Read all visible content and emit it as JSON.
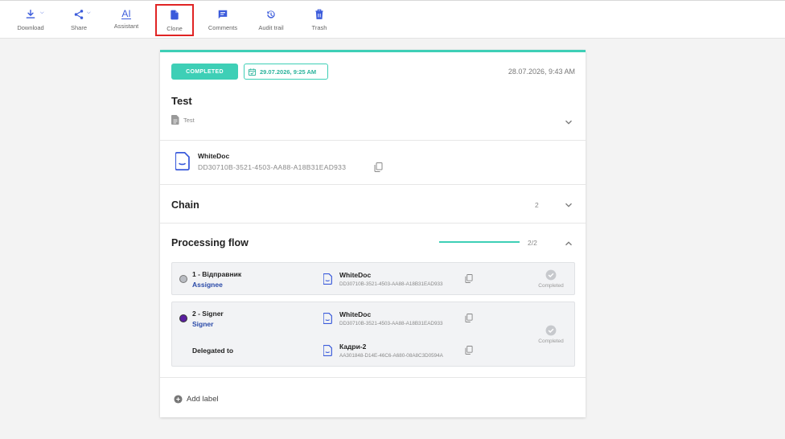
{
  "toolbar": {
    "download": "Download",
    "share": "Share",
    "assistant": "Assistant",
    "assistant_glyph": "AI",
    "clone": "Clone",
    "comments": "Comments",
    "audit_trail": "Audit trail",
    "trash": "Trash"
  },
  "document": {
    "status": "COMPLETED",
    "deadline": "29.07.2026, 9:25 AM",
    "created": "28.07.2026, 9:43 AM",
    "title": "Test",
    "type": "Test",
    "file": {
      "name": "WhiteDoc",
      "id": "DD30710B-3521-4503-AA88-A18B31EAD933"
    }
  },
  "chain": {
    "title": "Chain",
    "count": "2"
  },
  "processing_flow": {
    "title": "Processing flow",
    "progress_text": "2/2",
    "progress_fraction": 1.0,
    "steps": [
      {
        "name": "1 - Відправник",
        "role": "Assignee",
        "file_name": "WhiteDoc",
        "file_id": "DD30710B-3521-4503-AA88-A18B31EAD933",
        "status": "Completed",
        "dot_color": "#b9bcc2"
      },
      {
        "name": "2 - Signer",
        "role": "Signer",
        "file_name": "WhiteDoc",
        "file_id": "DD30710B-3521-4503-AA88-A18B31EAD933",
        "delegated_label": "Delegated to",
        "delegated_file_name": "Кадри-2",
        "delegated_file_id": "AA301848-D14E-46C6-A680-08A8C3D0594A",
        "status": "Completed",
        "dot_color": "#5a1fa0"
      }
    ]
  },
  "add_label": "Add label",
  "colors": {
    "accent": "#3ecfb6",
    "toolbar_icon": "#3b5bdb",
    "role_link": "#2a4aa8",
    "highlight": "#e02424"
  }
}
